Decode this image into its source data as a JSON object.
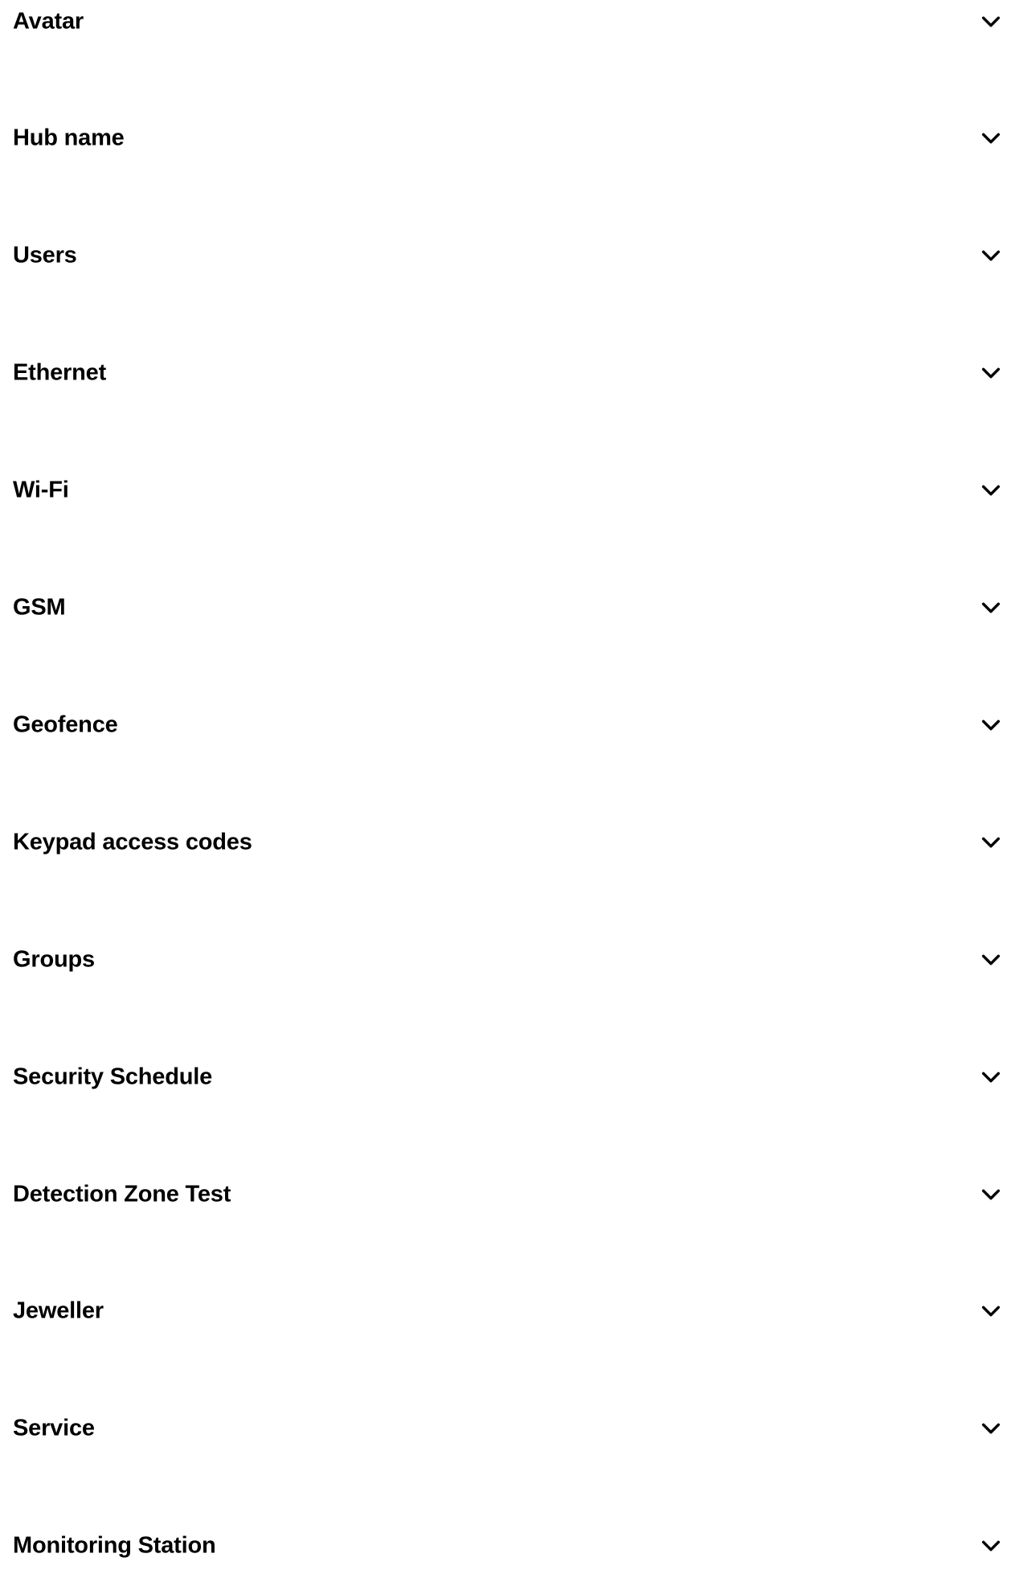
{
  "accordion": {
    "items": [
      {
        "label": "Avatar",
        "icon": "chevron-down-icon"
      },
      {
        "label": "Hub name",
        "icon": "chevron-down-icon"
      },
      {
        "label": "Users",
        "icon": "chevron-down-icon"
      },
      {
        "label": "Ethernet",
        "icon": "chevron-down-icon"
      },
      {
        "label": "Wi-Fi",
        "icon": "chevron-down-icon"
      },
      {
        "label": "GSM",
        "icon": "chevron-down-icon"
      },
      {
        "label": "Geofence",
        "icon": "chevron-down-icon"
      },
      {
        "label": "Keypad access codes",
        "icon": "chevron-down-icon"
      },
      {
        "label": "Groups",
        "icon": "chevron-down-icon"
      },
      {
        "label": "Security Schedule",
        "icon": "chevron-down-icon"
      },
      {
        "label": "Detection Zone Test",
        "icon": "chevron-down-icon"
      },
      {
        "label": "Jeweller",
        "icon": "chevron-down-icon"
      },
      {
        "label": "Service",
        "icon": "chevron-down-icon"
      },
      {
        "label": "Monitoring Station",
        "icon": "chevron-down-icon"
      }
    ]
  },
  "colors": {
    "background": "#ffffff",
    "text": "#000000"
  }
}
